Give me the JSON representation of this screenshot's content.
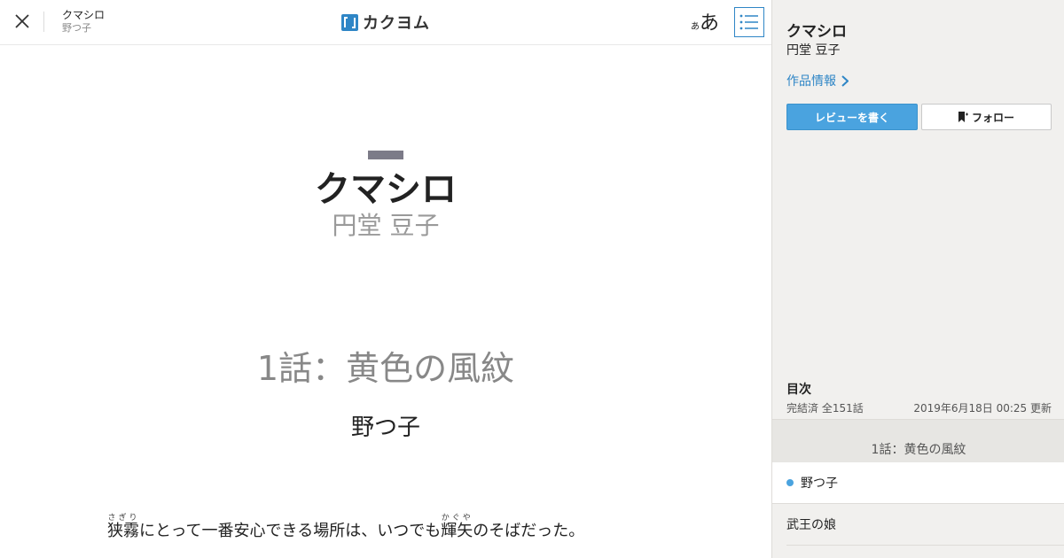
{
  "header": {
    "close_icon": "close-icon",
    "work_title": "クマシロ",
    "work_author": "野つ子",
    "logo_text": "カクヨム",
    "font_size_small": "あ",
    "font_size_large": "あ",
    "toc_icon": "list-icon"
  },
  "content": {
    "title": "クマシロ",
    "author": "円堂 豆子",
    "episode_heading": "1話：黄色の風紋",
    "chapter_subtitle": "野つ子",
    "body": {
      "name1": "狭霧",
      "name1_reading": "さぎり",
      "segment1": "にとって一番安心できる場所は、いつでも",
      "name2": "輝矢",
      "name2_reading": "かぐや",
      "segment2": "のそばだった。"
    }
  },
  "sidebar": {
    "title": "クマシロ",
    "author": "円堂 豆子",
    "work_info_link": "作品情報",
    "review_button": "レビューを書く",
    "follow_button": "フォロー",
    "toc_heading": "目次",
    "status": "完結済 全151話",
    "updated": "2019年6月18日 00:25 更新",
    "chapter": "1話：黄色の風紋",
    "episodes": [
      {
        "label": "野つ子",
        "current": true
      },
      {
        "label": "武王の娘",
        "current": false
      }
    ]
  },
  "colors": {
    "accent": "#2f86c6",
    "review_button": "#4aa3df",
    "sidebar_bg": "#f1f0ee"
  }
}
